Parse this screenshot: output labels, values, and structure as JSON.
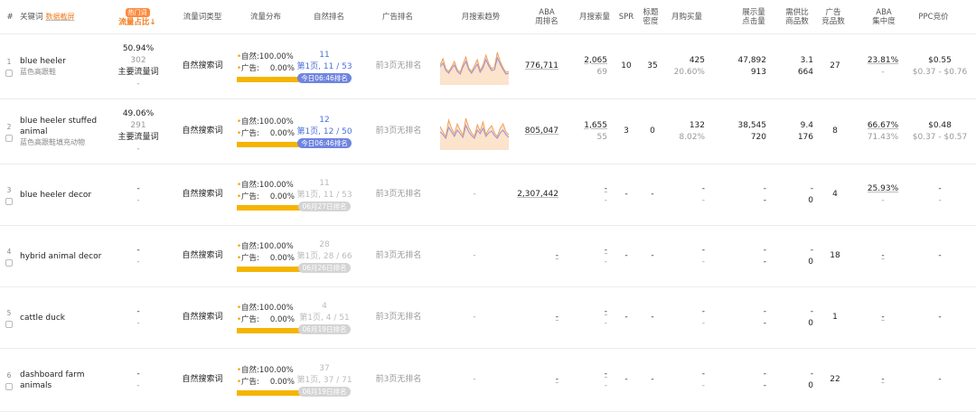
{
  "header": {
    "idx": "#",
    "keyword": "关键词",
    "data_source": "数据截屏",
    "hot_badge": "热门词",
    "flow_ratio": "流量占比",
    "flow_sort": "↓",
    "kw_type": "流量词类型",
    "flow_dist": "流量分布",
    "organic_rank": "自然排名",
    "ad_rank": "广告排名",
    "trend": "月搜索趋势",
    "aba_rank_1": "ABA",
    "aba_rank_2": "周排名",
    "monthly_search": "月搜索量",
    "spr": "SPR",
    "title_density_1": "标题",
    "title_density_2": "密度",
    "monthly_purchase": "月购买量",
    "impressions_1": "展示量",
    "impressions_2": "点击量",
    "supply_ratio_1": "需供比",
    "supply_ratio_2": "商品数",
    "ad_count_1": "广告",
    "ad_count_2": "竞品数",
    "aba_conc_1": "ABA",
    "aba_conc_2": "集中度",
    "ppc": "PPC竞价"
  },
  "rows": [
    {
      "idx": "1",
      "keyword": "blue heeler",
      "keyword_cn": "蓝色高跟鞋",
      "flow_pct": "50.94%",
      "flow_sub": "302",
      "flow_tag": "主要流量词",
      "flow_dash": "-",
      "kw_type": "自然搜索词",
      "organic_label": "自然:",
      "organic_val": "100.00%",
      "ad_label": "广告:",
      "ad_val": "0.00%",
      "organic_fill": 1.0,
      "rank_num": "11",
      "rank_detail": "第1页, 11 / 53",
      "rank_badge": "今日06:46排名",
      "rank_active": true,
      "ad_rank": "前3页无排名",
      "trend": [
        44,
        58,
        36,
        30,
        40,
        52,
        34,
        28,
        46,
        62,
        38,
        30,
        42,
        56,
        32,
        44,
        66,
        48,
        36,
        40,
        72,
        52,
        38,
        28,
        30
      ],
      "trend2": [
        40,
        48,
        32,
        26,
        36,
        44,
        30,
        24,
        40,
        52,
        34,
        26,
        36,
        46,
        28,
        38,
        56,
        42,
        32,
        34,
        60,
        46,
        34,
        24,
        26
      ],
      "aba_rank": "776,711",
      "monthly_search": "2,065",
      "monthly_search_sub": "69",
      "spr": "10",
      "title_density": "35",
      "purchase": "425",
      "purchase_sub": "20.60%",
      "impressions": "47,892",
      "clicks": "913",
      "supply_ratio": "3.1",
      "supply_count": "664",
      "ad_count": "27",
      "aba_conc": "23.81%",
      "aba_conc_sub": "-",
      "ppc": "$0.55",
      "ppc_range": "$0.37 - $0.76"
    },
    {
      "idx": "2",
      "keyword": "blue heeler stuffed animal",
      "keyword_cn": "蓝色高跟鞋填充动物",
      "flow_pct": "49.06%",
      "flow_sub": "291",
      "flow_tag": "主要流量词",
      "flow_dash": "-",
      "kw_type": "自然搜索词",
      "organic_label": "自然:",
      "organic_val": "100.00%",
      "ad_label": "广告:",
      "ad_val": "0.00%",
      "organic_fill": 1.0,
      "rank_num": "12",
      "rank_detail": "第1页, 12 / 50",
      "rank_badge": "今日06:46排名",
      "rank_active": true,
      "ad_rank": "前3页无排名",
      "trend": [
        52,
        40,
        30,
        66,
        48,
        36,
        58,
        44,
        32,
        70,
        50,
        38,
        30,
        56,
        42,
        62,
        34,
        46,
        54,
        38,
        30,
        48,
        58,
        40,
        34
      ],
      "trend2": [
        40,
        34,
        26,
        50,
        40,
        30,
        44,
        36,
        28,
        54,
        40,
        32,
        26,
        44,
        36,
        48,
        30,
        38,
        42,
        32,
        26,
        38,
        44,
        34,
        28
      ],
      "aba_rank": "805,047",
      "monthly_search": "1,655",
      "monthly_search_sub": "55",
      "spr": "3",
      "title_density": "0",
      "purchase": "132",
      "purchase_sub": "8.02%",
      "impressions": "38,545",
      "clicks": "720",
      "supply_ratio": "9.4",
      "supply_count": "176",
      "ad_count": "8",
      "aba_conc": "66.67%",
      "aba_conc_sub": "71.43%",
      "ppc": "$0.48",
      "ppc_range": "$0.37 - $0.57"
    },
    {
      "idx": "3",
      "keyword": "blue heeler decor",
      "keyword_cn": "",
      "flow_pct": "-",
      "flow_sub": "-",
      "flow_tag": "",
      "flow_dash": "",
      "kw_type": "自然搜索词",
      "organic_label": "自然:",
      "organic_val": "100.00%",
      "ad_label": "广告:",
      "ad_val": "0.00%",
      "organic_fill": 1.0,
      "rank_num": "11",
      "rank_detail": "第1页, 11 / 53",
      "rank_badge": "06月27日排名",
      "rank_active": false,
      "ad_rank": "前3页无排名",
      "trend": null,
      "trend_dash": "-",
      "aba_rank": "2,307,442",
      "monthly_search": "-",
      "monthly_search_sub": "-",
      "spr": "-",
      "title_density": "-",
      "purchase": "-",
      "purchase_sub": "-",
      "impressions": "-",
      "clicks": "-",
      "supply_ratio": "-",
      "supply_count": "0",
      "ad_count": "4",
      "aba_conc": "25.93%",
      "aba_conc_sub": "-",
      "ppc": "-",
      "ppc_range": "-"
    },
    {
      "idx": "4",
      "keyword": "hybrid animal decor",
      "keyword_cn": "",
      "flow_pct": "-",
      "flow_sub": "-",
      "flow_tag": "",
      "flow_dash": "",
      "kw_type": "自然搜索词",
      "organic_label": "自然:",
      "organic_val": "100.00%",
      "ad_label": "广告:",
      "ad_val": "0.00%",
      "organic_fill": 1.0,
      "rank_num": "28",
      "rank_detail": "第1页, 28 / 66",
      "rank_badge": "06月26日排名",
      "rank_active": false,
      "ad_rank": "前3页无排名",
      "trend": null,
      "trend_dash": "-",
      "aba_rank": "-",
      "monthly_search": "-",
      "monthly_search_sub": "-",
      "spr": "-",
      "title_density": "-",
      "purchase": "-",
      "purchase_sub": "-",
      "impressions": "-",
      "clicks": "-",
      "supply_ratio": "-",
      "supply_count": "0",
      "ad_count": "18",
      "aba_conc": "-",
      "aba_conc_sub": "",
      "ppc": "-",
      "ppc_range": ""
    },
    {
      "idx": "5",
      "keyword": "cattle duck",
      "keyword_cn": "",
      "flow_pct": "-",
      "flow_sub": "-",
      "flow_tag": "",
      "flow_dash": "",
      "kw_type": "自然搜索词",
      "organic_label": "自然:",
      "organic_val": "100.00%",
      "ad_label": "广告:",
      "ad_val": "0.00%",
      "organic_fill": 1.0,
      "rank_num": "4",
      "rank_detail": "第1页, 4 / 51",
      "rank_badge": "06月19日排名",
      "rank_active": false,
      "ad_rank": "前3页无排名",
      "trend": null,
      "trend_dash": "-",
      "aba_rank": "-",
      "monthly_search": "-",
      "monthly_search_sub": "-",
      "spr": "-",
      "title_density": "-",
      "purchase": "-",
      "purchase_sub": "-",
      "impressions": "-",
      "clicks": "-",
      "supply_ratio": "-",
      "supply_count": "0",
      "ad_count": "1",
      "aba_conc": "-",
      "aba_conc_sub": "",
      "ppc": "-",
      "ppc_range": ""
    },
    {
      "idx": "6",
      "keyword": "dashboard farm animals",
      "keyword_cn": "",
      "flow_pct": "-",
      "flow_sub": "-",
      "flow_tag": "",
      "flow_dash": "",
      "kw_type": "自然搜索词",
      "organic_label": "自然:",
      "organic_val": "100.00%",
      "ad_label": "广告:",
      "ad_val": "0.00%",
      "organic_fill": 1.0,
      "rank_num": "37",
      "rank_detail": "第1页, 37 / 71",
      "rank_badge": "06月19日排名",
      "rank_active": false,
      "ad_rank": "前3页无排名",
      "trend": null,
      "trend_dash": "-",
      "aba_rank": "-",
      "monthly_search": "-",
      "monthly_search_sub": "-",
      "spr": "-",
      "title_density": "-",
      "purchase": "-",
      "purchase_sub": "-",
      "impressions": "-",
      "clicks": "-",
      "supply_ratio": "-",
      "supply_count": "0",
      "ad_count": "22",
      "aba_conc": "-",
      "aba_conc_sub": "",
      "ppc": "-",
      "ppc_range": ""
    }
  ],
  "colors": {
    "accent_orange": "#f07a1a",
    "rank_blue": "#4a6fd8",
    "badge_blue": "#6f84e0",
    "bar_yellow": "#f5b400",
    "trend_orange": "#f2a057",
    "trend_purple": "#9a8fd8",
    "trend_fill": "#fbe3cc"
  },
  "icons": {
    "checkbox": "checkbox-icon",
    "sort": "sort-desc-icon"
  }
}
